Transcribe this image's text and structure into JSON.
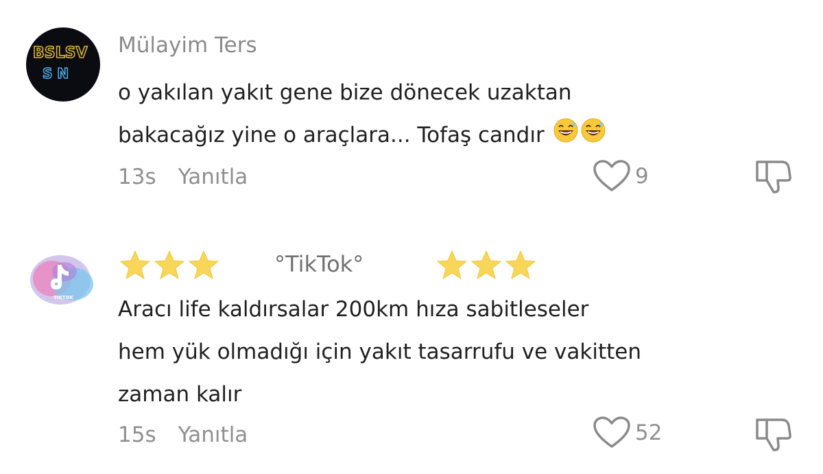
{
  "comments": [
    {
      "username": "Mülayim Ters",
      "lines": [
        "o yakılan yakıt gene bize dönecek uzaktan",
        "bakacağız yine o araçlara... Tofaş candır"
      ],
      "time": "13s",
      "reply_label": "Yanıtla",
      "likes": "9",
      "emoji": "sweat-smile-emoji"
    },
    {
      "username": "°TikTok°",
      "lines": [
        "Aracı life kaldırsalar 200km hıza sabitleseler",
        "hem yük olmadığı için yakıt tasarrufu ve vakitten",
        "zaman kalır"
      ],
      "time": "15s",
      "reply_label": "Yanıtla",
      "likes": "52"
    }
  ],
  "colors": {
    "meta_gray": "#8f8f8f",
    "star_yellow": "#f7d65a"
  },
  "icons": [
    "heart-icon",
    "dislike-icon",
    "star-icon"
  ]
}
